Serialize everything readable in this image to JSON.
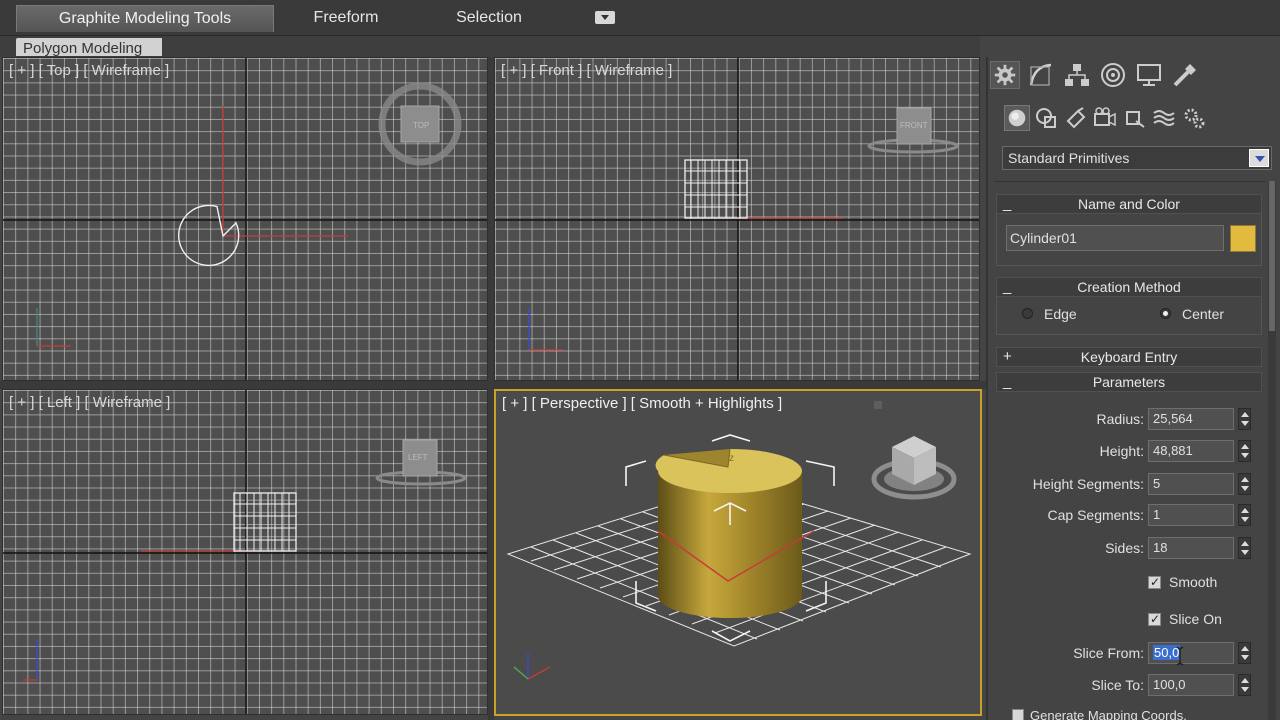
{
  "ribbon": {
    "tabs": [
      "Graphite Modeling Tools",
      "Freeform",
      "Selection"
    ],
    "subtab": "Polygon Modeling"
  },
  "viewports": {
    "top_label": "[ + ] [ Top ] [ Wireframe ]",
    "front_label": "[ + ] [ Front ] [ Wireframe ]",
    "left_label": "[ + ] [ Left ] [ Wireframe ]",
    "persp_label": "[ + ] [ Perspective ] [ Smooth + Highlights ]",
    "navcube_top": "TOP",
    "navcube_front": "FRONT",
    "navcube_left": "LEFT",
    "axis_x": "x",
    "axis_y": "y",
    "axis_z": "z"
  },
  "panel": {
    "tab_icons": [
      "create-icon",
      "modify-icon",
      "hierarchy-icon",
      "motion-icon",
      "display-icon",
      "utilities-icon"
    ],
    "category_icons": [
      "geometry-icon",
      "shapes-icon",
      "lights-icon",
      "cameras-icon",
      "helpers-icon",
      "spacewarps-icon",
      "systems-icon"
    ],
    "object_type": "Standard Primitives",
    "name_and_color": {
      "title": "Name and Color",
      "name": "Cylinder01",
      "color": "#e2bb3e"
    },
    "creation_method": {
      "title": "Creation Method",
      "options": [
        "Edge",
        "Center"
      ],
      "selected": "Center"
    },
    "keyboard_entry": {
      "title": "Keyboard Entry"
    },
    "parameters": {
      "title": "Parameters",
      "fields": [
        {
          "label": "Radius:",
          "value": "25,564"
        },
        {
          "label": "Height:",
          "value": "48,881"
        },
        {
          "label": "Height Segments:",
          "value": "5"
        },
        {
          "label": "Cap Segments:",
          "value": "1"
        },
        {
          "label": "Sides:",
          "value": "18"
        }
      ],
      "smooth": {
        "label": "Smooth",
        "checked": true
      },
      "slice_on": {
        "label": "Slice On",
        "checked": true
      },
      "slice_from": {
        "label": "Slice From:",
        "value": "50,0"
      },
      "slice_to": {
        "label": "Slice To:",
        "value": "100,0"
      },
      "gen_mapping": "Generate Mapping Coords."
    }
  }
}
